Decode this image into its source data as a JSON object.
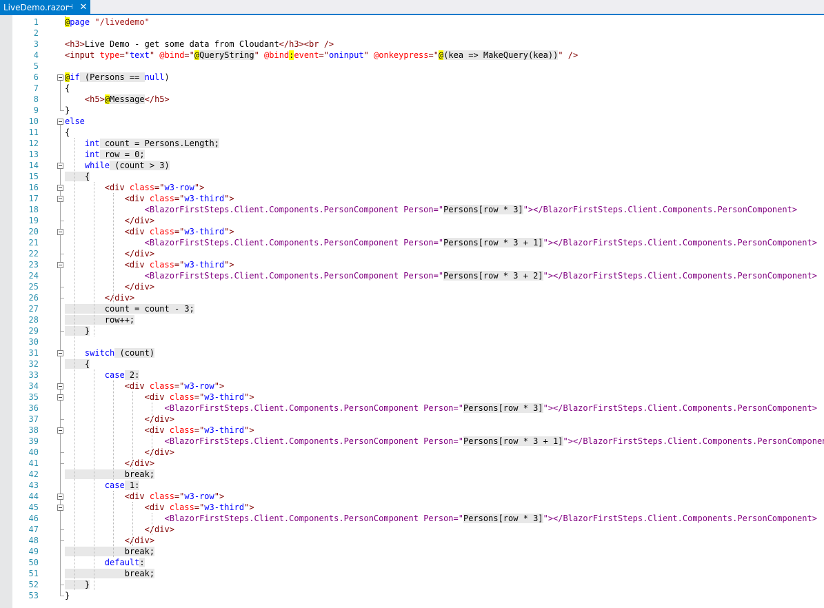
{
  "tab": {
    "filename": "LiveDemo.razor",
    "pin_icon": "pin-icon",
    "close_icon": "close-icon"
  },
  "colors": {
    "accent": "#007acc",
    "line_number": "#2b91af",
    "keyword": "#0000ff",
    "string": "#a31515",
    "html_tag": "#800000",
    "html_attr": "#ff0000",
    "component": "#800080",
    "razor_highlight": "#ffff00",
    "razor_code_bg": "#e8e8e8"
  },
  "lines": [
    {
      "n": "1",
      "t": [
        [
          "@",
          "r"
        ],
        [
          "page",
          "k"
        ],
        [
          " ",
          "g"
        ],
        [
          "\"/livedemo\"",
          "s"
        ]
      ]
    },
    {
      "n": "2",
      "t": []
    },
    {
      "n": "3",
      "t": [
        [
          "<h3>",
          "t"
        ],
        [
          "Live Demo - get some data from Cloudant",
          "g"
        ],
        [
          "</h3><br />",
          "t"
        ]
      ]
    },
    {
      "n": "4",
      "t": [
        [
          "<input ",
          "t"
        ],
        [
          "type",
          "a"
        ],
        [
          "=\"",
          "t"
        ],
        [
          "text",
          "k"
        ],
        [
          "\" ",
          "t"
        ],
        [
          "@bind",
          "a"
        ],
        [
          "=\"",
          "t"
        ],
        [
          "@",
          "r"
        ],
        [
          "QueryString",
          "g"
        ],
        [
          "\" ",
          "t"
        ],
        [
          "@bind",
          "a"
        ],
        [
          ":",
          "r"
        ],
        [
          "event",
          "a"
        ],
        [
          "=\"",
          "t"
        ],
        [
          "oninput",
          "k"
        ],
        [
          "\" ",
          "t"
        ],
        [
          "@onkeypress",
          "a"
        ],
        [
          "=\"",
          "t"
        ],
        [
          "@",
          "r"
        ],
        [
          "(kea => MakeQuery(kea))",
          "g"
        ],
        [
          "\" />",
          "t"
        ]
      ]
    },
    {
      "n": "5",
      "t": []
    },
    {
      "n": "6",
      "t": [
        [
          "@",
          "r"
        ],
        [
          "if",
          "k"
        ],
        [
          " (Persons == ",
          "g"
        ],
        [
          "null",
          "k"
        ],
        [
          ")",
          "g"
        ]
      ]
    },
    {
      "n": "7",
      "t": [
        [
          "{",
          "g"
        ]
      ]
    },
    {
      "n": "8",
      "t": [
        [
          "    ",
          "g"
        ],
        [
          "<h5>",
          "t"
        ],
        [
          "@",
          "r"
        ],
        [
          "Message",
          "g"
        ],
        [
          "</h5>",
          "t"
        ]
      ]
    },
    {
      "n": "9",
      "t": [
        [
          "}",
          "g"
        ]
      ]
    },
    {
      "n": "10",
      "t": [
        [
          "else",
          "k"
        ]
      ]
    },
    {
      "n": "11",
      "t": [
        [
          "{",
          "g"
        ]
      ]
    },
    {
      "n": "12",
      "t": [
        [
          "    ",
          "g"
        ],
        [
          "int",
          "k"
        ],
        [
          " count = Persons.Length;",
          "g"
        ]
      ]
    },
    {
      "n": "13",
      "t": [
        [
          "    ",
          "g"
        ],
        [
          "int",
          "k"
        ],
        [
          " row = 0;",
          "g"
        ]
      ]
    },
    {
      "n": "14",
      "t": [
        [
          "    ",
          "g"
        ],
        [
          "while",
          "k"
        ],
        [
          " (count > 3)",
          "g"
        ]
      ]
    },
    {
      "n": "15",
      "t": [
        [
          "    {",
          "g"
        ]
      ]
    },
    {
      "n": "16",
      "t": [
        [
          "        ",
          "g"
        ],
        [
          "<div ",
          "t"
        ],
        [
          "class",
          "a"
        ],
        [
          "=\"",
          "t"
        ],
        [
          "w3-row",
          "k"
        ],
        [
          "\">",
          "t"
        ]
      ]
    },
    {
      "n": "17",
      "t": [
        [
          "            ",
          "g"
        ],
        [
          "<div ",
          "t"
        ],
        [
          "class",
          "a"
        ],
        [
          "=\"",
          "t"
        ],
        [
          "w3-third",
          "k"
        ],
        [
          "\">",
          "t"
        ]
      ]
    },
    {
      "n": "18",
      "t": [
        [
          "                ",
          "g"
        ],
        [
          "<BlazorFirstSteps.Client.Components.PersonComponent ",
          "p"
        ],
        [
          "Person",
          "p"
        ],
        [
          "=\"",
          "p"
        ],
        [
          "Persons[row * 3]",
          "g"
        ],
        [
          "\"></BlazorFirstSteps.Client.Components.PersonComponent>",
          "p"
        ]
      ]
    },
    {
      "n": "19",
      "t": [
        [
          "            ",
          "g"
        ],
        [
          "</div>",
          "t"
        ]
      ]
    },
    {
      "n": "20",
      "t": [
        [
          "            ",
          "g"
        ],
        [
          "<div ",
          "t"
        ],
        [
          "class",
          "a"
        ],
        [
          "=\"",
          "t"
        ],
        [
          "w3-third",
          "k"
        ],
        [
          "\">",
          "t"
        ]
      ]
    },
    {
      "n": "21",
      "t": [
        [
          "                ",
          "g"
        ],
        [
          "<BlazorFirstSteps.Client.Components.PersonComponent ",
          "p"
        ],
        [
          "Person",
          "p"
        ],
        [
          "=\"",
          "p"
        ],
        [
          "Persons[row * 3 + 1]",
          "g"
        ],
        [
          "\"></BlazorFirstSteps.Client.Components.PersonComponent>",
          "p"
        ]
      ]
    },
    {
      "n": "22",
      "t": [
        [
          "            ",
          "g"
        ],
        [
          "</div>",
          "t"
        ]
      ]
    },
    {
      "n": "23",
      "t": [
        [
          "            ",
          "g"
        ],
        [
          "<div ",
          "t"
        ],
        [
          "class",
          "a"
        ],
        [
          "=\"",
          "t"
        ],
        [
          "w3-third",
          "k"
        ],
        [
          "\">",
          "t"
        ]
      ]
    },
    {
      "n": "24",
      "t": [
        [
          "                ",
          "g"
        ],
        [
          "<BlazorFirstSteps.Client.Components.PersonComponent ",
          "p"
        ],
        [
          "Person",
          "p"
        ],
        [
          "=\"",
          "p"
        ],
        [
          "Persons[row * 3 + 2]",
          "g"
        ],
        [
          "\"></BlazorFirstSteps.Client.Components.PersonComponent>",
          "p"
        ]
      ]
    },
    {
      "n": "25",
      "t": [
        [
          "            ",
          "g"
        ],
        [
          "</div>",
          "t"
        ]
      ]
    },
    {
      "n": "26",
      "t": [
        [
          "        ",
          "g"
        ],
        [
          "</div>",
          "t"
        ]
      ]
    },
    {
      "n": "27",
      "t": [
        [
          "        count = count - 3;",
          "g"
        ]
      ]
    },
    {
      "n": "28",
      "t": [
        [
          "        row++;",
          "g"
        ]
      ]
    },
    {
      "n": "29",
      "t": [
        [
          "    }",
          "g"
        ]
      ]
    },
    {
      "n": "30",
      "t": []
    },
    {
      "n": "31",
      "t": [
        [
          "    ",
          "g"
        ],
        [
          "switch",
          "k"
        ],
        [
          " (count)",
          "g"
        ]
      ]
    },
    {
      "n": "32",
      "t": [
        [
          "    {",
          "g"
        ]
      ]
    },
    {
      "n": "33",
      "t": [
        [
          "        ",
          "g"
        ],
        [
          "case",
          "k"
        ],
        [
          " 2:",
          "g"
        ]
      ]
    },
    {
      "n": "34",
      "t": [
        [
          "            ",
          "g"
        ],
        [
          "<div ",
          "t"
        ],
        [
          "class",
          "a"
        ],
        [
          "=\"",
          "t"
        ],
        [
          "w3-row",
          "k"
        ],
        [
          "\">",
          "t"
        ]
      ]
    },
    {
      "n": "35",
      "t": [
        [
          "                ",
          "g"
        ],
        [
          "<div ",
          "t"
        ],
        [
          "class",
          "a"
        ],
        [
          "=\"",
          "t"
        ],
        [
          "w3-third",
          "k"
        ],
        [
          "\">",
          "t"
        ]
      ]
    },
    {
      "n": "36",
      "t": [
        [
          "                    ",
          "g"
        ],
        [
          "<BlazorFirstSteps.Client.Components.PersonComponent ",
          "p"
        ],
        [
          "Person",
          "p"
        ],
        [
          "=\"",
          "p"
        ],
        [
          "Persons[row * 3]",
          "g"
        ],
        [
          "\"></BlazorFirstSteps.Client.Components.PersonComponent>",
          "p"
        ]
      ]
    },
    {
      "n": "37",
      "t": [
        [
          "                ",
          "g"
        ],
        [
          "</div>",
          "t"
        ]
      ]
    },
    {
      "n": "38",
      "t": [
        [
          "                ",
          "g"
        ],
        [
          "<div ",
          "t"
        ],
        [
          "class",
          "a"
        ],
        [
          "=\"",
          "t"
        ],
        [
          "w3-third",
          "k"
        ],
        [
          "\">",
          "t"
        ]
      ]
    },
    {
      "n": "39",
      "t": [
        [
          "                    ",
          "g"
        ],
        [
          "<BlazorFirstSteps.Client.Components.PersonComponent ",
          "p"
        ],
        [
          "Person",
          "p"
        ],
        [
          "=\"",
          "p"
        ],
        [
          "Persons[row * 3 + 1]",
          "g"
        ],
        [
          "\"></BlazorFirstSteps.Client.Components.PersonComponent>",
          "p"
        ]
      ]
    },
    {
      "n": "40",
      "t": [
        [
          "                ",
          "g"
        ],
        [
          "</div>",
          "t"
        ]
      ]
    },
    {
      "n": "41",
      "t": [
        [
          "            ",
          "g"
        ],
        [
          "</div>",
          "t"
        ]
      ]
    },
    {
      "n": "42",
      "t": [
        [
          "            break;",
          "g"
        ]
      ]
    },
    {
      "n": "43",
      "t": [
        [
          "        ",
          "g"
        ],
        [
          "case",
          "k"
        ],
        [
          " 1:",
          "g"
        ]
      ]
    },
    {
      "n": "44",
      "t": [
        [
          "            ",
          "g"
        ],
        [
          "<div ",
          "t"
        ],
        [
          "class",
          "a"
        ],
        [
          "=\"",
          "t"
        ],
        [
          "w3-row",
          "k"
        ],
        [
          "\">",
          "t"
        ]
      ]
    },
    {
      "n": "45",
      "t": [
        [
          "                ",
          "g"
        ],
        [
          "<div ",
          "t"
        ],
        [
          "class",
          "a"
        ],
        [
          "=\"",
          "t"
        ],
        [
          "w3-third",
          "k"
        ],
        [
          "\">",
          "t"
        ]
      ]
    },
    {
      "n": "46",
      "t": [
        [
          "                    ",
          "g"
        ],
        [
          "<BlazorFirstSteps.Client.Components.PersonComponent ",
          "p"
        ],
        [
          "Person",
          "p"
        ],
        [
          "=\"",
          "p"
        ],
        [
          "Persons[row * 3]",
          "g"
        ],
        [
          "\"></BlazorFirstSteps.Client.Components.PersonComponent>",
          "p"
        ]
      ]
    },
    {
      "n": "47",
      "t": [
        [
          "                ",
          "g"
        ],
        [
          "</div>",
          "t"
        ]
      ]
    },
    {
      "n": "48",
      "t": [
        [
          "            ",
          "g"
        ],
        [
          "</div>",
          "t"
        ]
      ]
    },
    {
      "n": "49",
      "t": [
        [
          "            break;",
          "g"
        ]
      ]
    },
    {
      "n": "50",
      "t": [
        [
          "        ",
          "g"
        ],
        [
          "default",
          "k"
        ],
        [
          ":",
          "g"
        ]
      ]
    },
    {
      "n": "51",
      "t": [
        [
          "            break;",
          "g"
        ]
      ]
    },
    {
      "n": "52",
      "t": [
        [
          "    }",
          "g"
        ]
      ]
    },
    {
      "n": "53",
      "t": [
        [
          "}",
          "g"
        ]
      ]
    }
  ]
}
